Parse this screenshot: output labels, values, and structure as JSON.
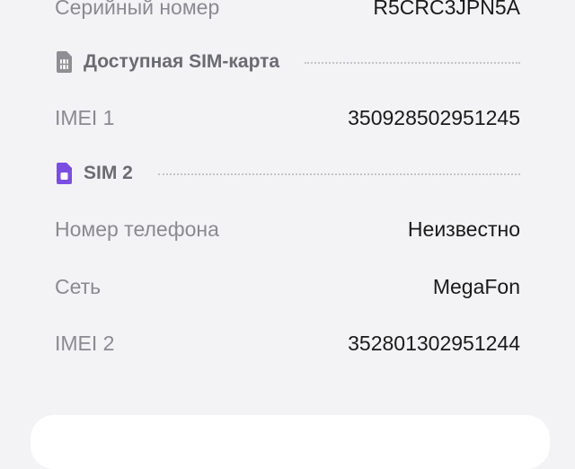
{
  "rows_top": [
    {
      "label": "Серийный номер",
      "value": "R5CRC3JPN5A"
    }
  ],
  "sections": [
    {
      "title": "Доступная SIM-карта",
      "icon": "sim-card-icon",
      "icon_color": "#8e8e94"
    },
    {
      "title": "SIM 2",
      "icon": "sim-card-icon",
      "icon_color": "#7a4fe0"
    }
  ],
  "available_sim_rows": [
    {
      "label": "IMEI 1",
      "value": "350928502951245"
    }
  ],
  "sim2_rows": [
    {
      "label": "Номер телефона",
      "value": "Неизвестно"
    },
    {
      "label": "Сеть",
      "value": "MegaFon"
    },
    {
      "label": "IMEI 2",
      "value": "352801302951244"
    }
  ],
  "colors": {
    "background": "#f3f3f5",
    "sim2_accent": "#7a4fe0",
    "label": "#8a8a90",
    "value": "#1a1a1a"
  }
}
